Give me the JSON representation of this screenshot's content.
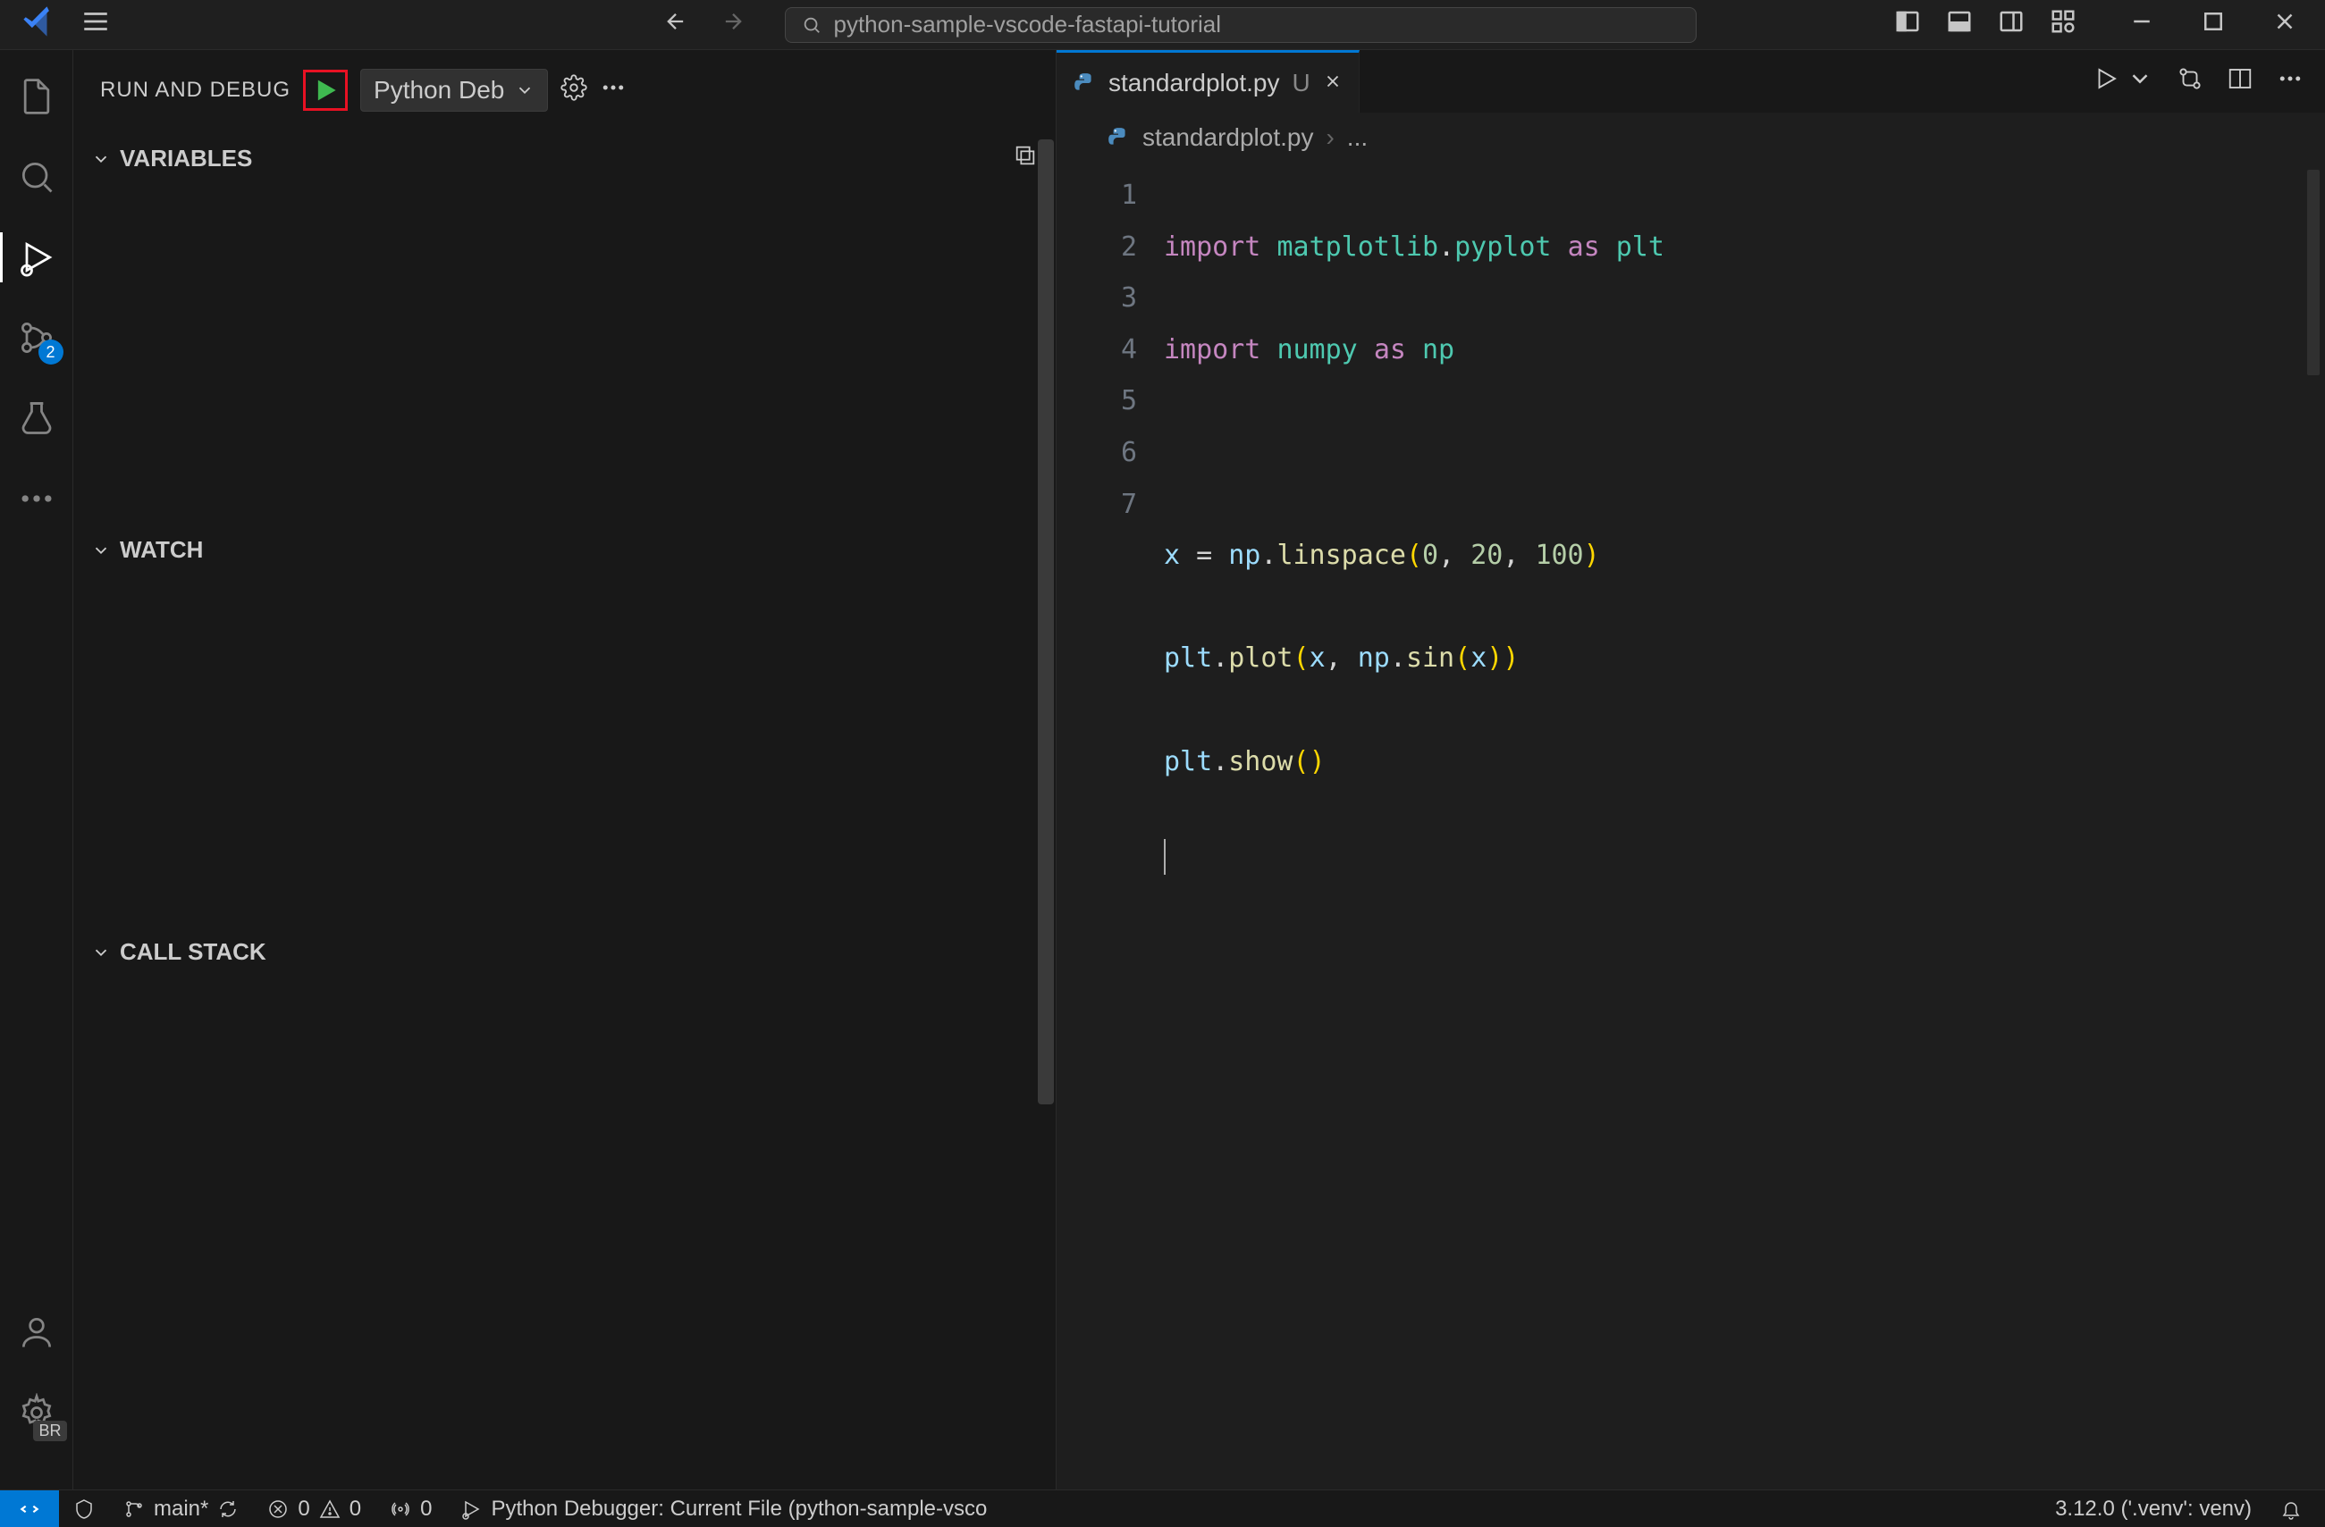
{
  "titlebar": {
    "search_text": "python-sample-vscode-fastapi-tutorial"
  },
  "activity": {
    "scm_badge": "2",
    "ext_badge": "BR"
  },
  "debug_panel": {
    "title": "RUN AND DEBUG",
    "config_label": "Python Deb",
    "sections": {
      "variables": "VARIABLES",
      "watch": "WATCH",
      "callstack": "CALL STACK"
    }
  },
  "editor": {
    "tab_name": "standardplot.py",
    "tab_modified_marker": "U",
    "breadcrumb_file": "standardplot.py",
    "breadcrumb_more": "...",
    "line_numbers": [
      "1",
      "2",
      "3",
      "4",
      "5",
      "6",
      "7"
    ],
    "code": {
      "l1": {
        "kw": "import",
        "sp": " ",
        "m1": "matplotlib",
        "dot": ".",
        "m2": "pyplot",
        "sp2": " ",
        "as": "as",
        "sp3": " ",
        "alias": "plt"
      },
      "l2": {
        "kw": "import",
        "sp": " ",
        "m1": "numpy",
        "sp2": " ",
        "as": "as",
        "sp3": " ",
        "alias": "np"
      },
      "l4": {
        "v": "x",
        "sp": " ",
        "eq": "=",
        "sp2": " ",
        "obj": "np",
        "dot": ".",
        "fn": "linspace",
        "lp": "(",
        "n1": "0",
        "c1": ", ",
        "n2": "20",
        "c2": ", ",
        "n3": "100",
        "rp": ")"
      },
      "l5": {
        "obj": "plt",
        "dot": ".",
        "fn": "plot",
        "lp": "(",
        "a1": "x",
        "c1": ", ",
        "obj2": "np",
        "dot2": ".",
        "fn2": "sin",
        "lp2": "(",
        "a2": "x",
        "rp2": ")",
        "rp": ")"
      },
      "l6": {
        "obj": "plt",
        "dot": ".",
        "fn": "show",
        "lp": "(",
        "rp": ")"
      }
    }
  },
  "status": {
    "branch": "main*",
    "errors": "0",
    "warnings": "0",
    "ports": "0",
    "debug_target": "Python Debugger: Current File (python-sample-vsco",
    "interpreter": "3.12.0 ('.venv': venv)"
  }
}
